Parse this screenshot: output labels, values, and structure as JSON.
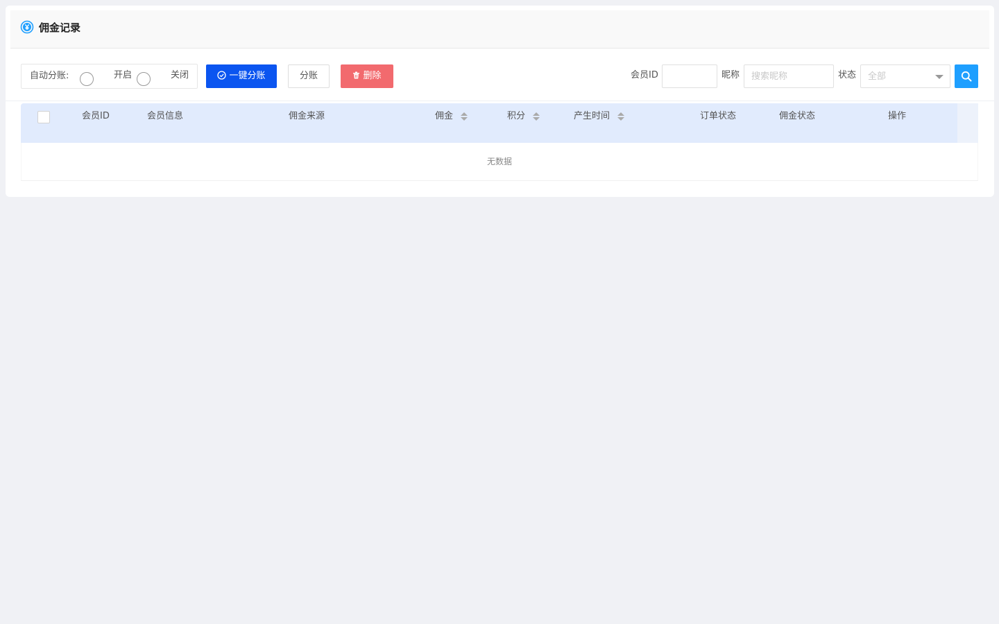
{
  "header": {
    "title": "佣金记录",
    "icon": "yen-icon"
  },
  "toolbar": {
    "auto_split_label": "自动分账:",
    "radio_on_label": "开启",
    "radio_off_label": "关闭",
    "one_click_split_label": "一键分账",
    "split_label": "分账",
    "delete_label": "删除"
  },
  "filters": {
    "member_id_label": "会员ID",
    "member_id_value": "",
    "nickname_label": "昵称",
    "nickname_placeholder": "搜索昵称",
    "status_label": "状态",
    "status_selected": "全部"
  },
  "table": {
    "columns": [
      "会员ID",
      "会员信息",
      "佣金来源",
      "佣金",
      "积分",
      "产生时间",
      "订单状态",
      "佣金状态",
      "操作"
    ],
    "empty_text": "无数据"
  },
  "colors": {
    "primary": "#0b55f0",
    "danger": "#f26a6e",
    "search": "#1e9fff",
    "table_header": "#e1ebfd",
    "background": "#f0f1f5"
  }
}
